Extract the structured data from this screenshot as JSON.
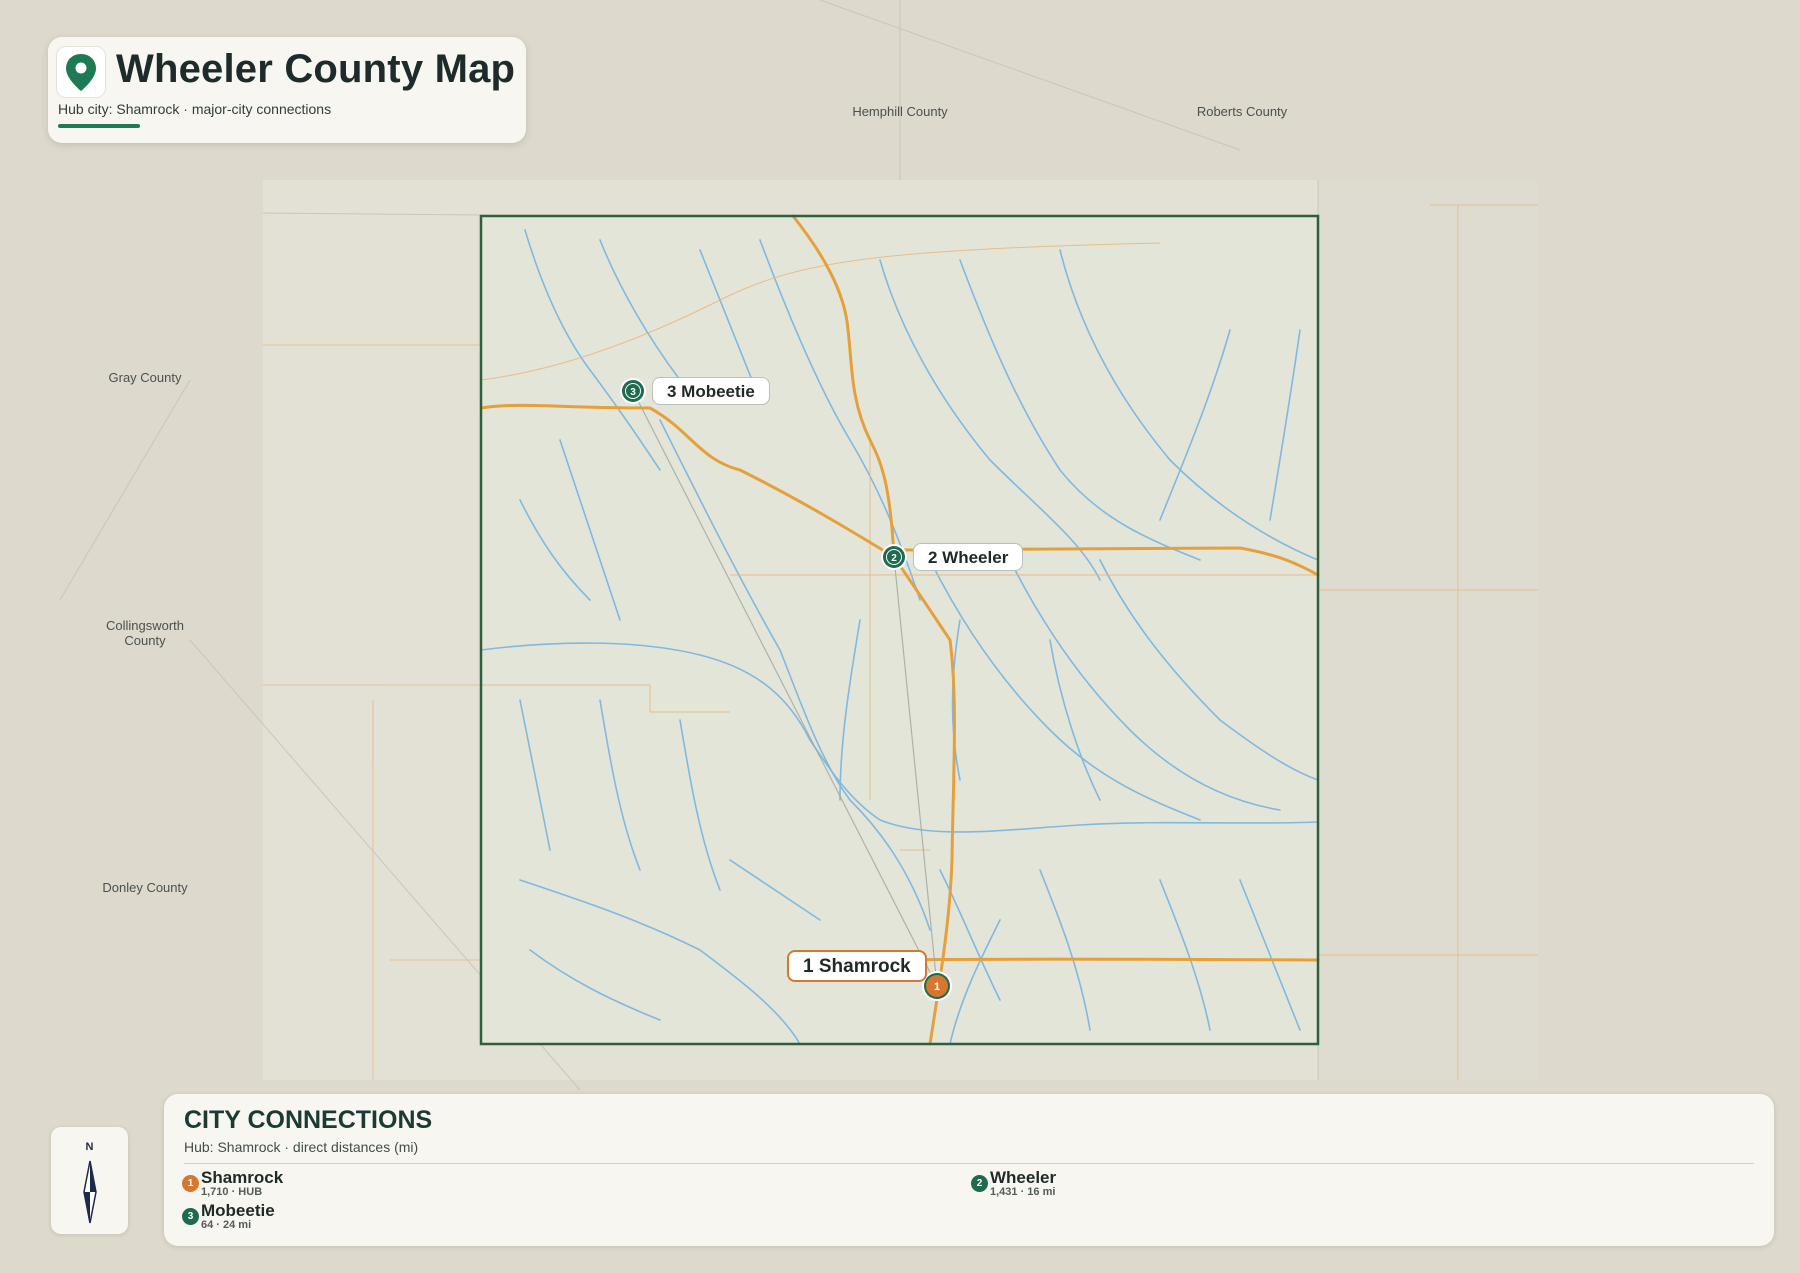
{
  "header": {
    "title": "Wheeler County Map",
    "subtitle": "Hub city: Shamrock · major-city connections",
    "pin_icon": "map-pin-icon",
    "accent_color": "#1e7a55"
  },
  "neighbor_counties": [
    {
      "name": "Hemphill County"
    },
    {
      "name": "Roberts County"
    },
    {
      "name": "Gray County"
    },
    {
      "name": "Collingsworth\nCounty"
    },
    {
      "name": "Donley County"
    }
  ],
  "cities": [
    {
      "number": "1",
      "name": "Shamrock",
      "label": "1 Shamrock",
      "population": "1,710",
      "info": "HUB",
      "is_hub": true,
      "color": "#d6772f"
    },
    {
      "number": "2",
      "name": "Wheeler",
      "label": "2 Wheeler",
      "population": "1,431",
      "info": "16 mi",
      "is_hub": false,
      "color": "#1e6b50"
    },
    {
      "number": "3",
      "name": "Mobeetie",
      "label": "3 Mobeetie",
      "population": "64",
      "info": "24 mi",
      "is_hub": false,
      "color": "#1e6b50"
    }
  ],
  "compass": {
    "label": "N",
    "icon": "north-arrow-icon"
  },
  "legend": {
    "title": "CITY CONNECTIONS",
    "subtitle": "Hub: Shamrock · direct distances (mi)",
    "items": [
      {
        "number": "1",
        "name": "Shamrock",
        "meta": "1,710 · HUB",
        "color": "#d6772f"
      },
      {
        "number": "2",
        "name": "Wheeler",
        "meta": "1,431 · 16 mi",
        "color": "#1e6b50"
      },
      {
        "number": "3",
        "name": "Mobeetie",
        "meta": "64 · 24 mi",
        "color": "#1e6b50"
      }
    ]
  },
  "colors": {
    "county_border": "#2f5e3a",
    "highway": "#e5a03c",
    "river": "#7fb9e0",
    "hub": "#d6772f",
    "city": "#1e6b50"
  }
}
